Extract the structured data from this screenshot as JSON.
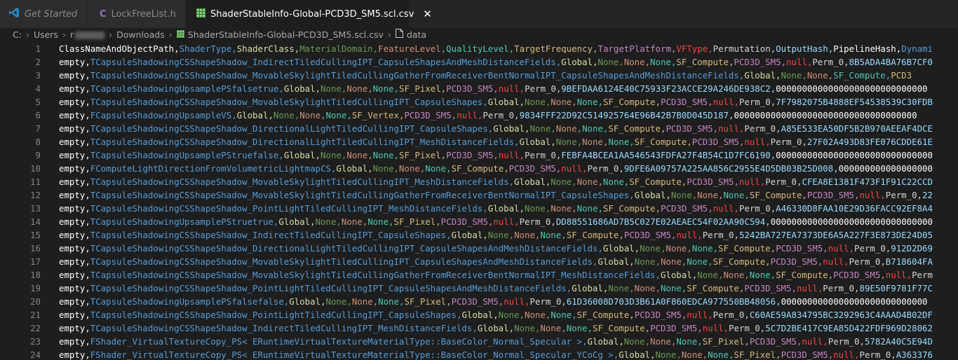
{
  "tabs": [
    {
      "label": "Get Started",
      "icon": "vscode-logo-icon",
      "active": false
    },
    {
      "label": "LockFreeList.h",
      "icon": "c-file-icon",
      "active": false
    },
    {
      "label": "ShaderStableInfo-Global-PCD3D_SM5.scl.csv",
      "icon": "csv-file-icon",
      "active": true
    }
  ],
  "breadcrumb": [
    "C:",
    "Users",
    "r",
    "Downloads",
    "ShaderStableInfo-Global-PCD3D_SM5.scl.csv",
    "data"
  ],
  "colors": {
    "editor_bg": "#1e1e1e",
    "rainbow": [
      "#ffffff",
      "#569cd6",
      "#dcdcaa",
      "#6a9955",
      "#ce9178",
      "#4ec9b0",
      "#d7ba7d",
      "#c586c0",
      "#f44747",
      "#d4d4d4",
      "#9cdcfe"
    ]
  },
  "lines": [
    {
      "n": "1",
      "text": "ClassNameAndObjectPath,ShaderType,ShaderClass,MaterialDomain,FeatureLevel,QualityLevel,TargetFrequency,TargetPlatform,VFType,Permutation,OutputHash,PipelineHash,Dynami"
    },
    {
      "n": "2",
      "text": "empty,TCapsuleShadowingCSShapeShadow_IndirectTiledCullingIPT_CapsuleShapesAndMeshDistanceFields,Global,None,None,None,SF_Compute,PCD3D_SM5,null,Perm_0,8B5ADA4BA76B7CF0"
    },
    {
      "n": "3",
      "text": "empty,TCapsuleShadowingCSShapeShadow_MovableSkylightTiledCullingGatherFromReceiverBentNormalIPT_CapsuleShapesAndMeshDistanceFields,Global,None,None,SF_Compute,PCD3"
    },
    {
      "n": "4",
      "text": "empty,TCapsuleShadowingUpsamplePSfalsetrue,Global,None,None,None,SF_Pixel,PCD3D_SM5,null,Perm_0,9BEFDAA6124E40C75933F23ACCE29A246DE938C2,00000000000000000000000000000"
    },
    {
      "n": "5",
      "text": "empty,TCapsuleShadowingCSShapeShadow_MovableSkylightTiledCullingIPT_CapsuleShapes,Global,None,None,None,SF_Compute,PCD3D_SM5,null,Perm_0,7F7982075B4888EF54538539C30FDB"
    },
    {
      "n": "6",
      "text": "empty,FCapsuleShadowingUpsampleVS,Global,None,None,None,SF_Vertex,PCD3D_SM5,null,Perm_0,9834FFF22D92C514925764E96B42B7B0D045D187,00000000000000000000000000000000000"
    },
    {
      "n": "7",
      "text": "empty,TCapsuleShadowingCSShapeShadow_DirectionalLightTiledCullingIPT_CapsuleShapes,Global,None,None,None,SF_Compute,PCD3D_SM5,null,Perm_0,A85E533EA50DF5B2B970AEEAF4DCE"
    },
    {
      "n": "8",
      "text": "empty,TCapsuleShadowingCSShapeShadow_DirectionalLightTiledCullingIPT_MeshDistanceFields,Global,None,None,None,SF_Compute,PCD3D_SM5,null,Perm_0,27F02A493D83FE076CDDE61E"
    },
    {
      "n": "9",
      "text": "empty,TCapsuleShadowingUpsamplePStruefalse,Global,None,None,None,SF_Pixel,PCD3D_SM5,null,Perm_0,FEBFA4BCEA1AA546543FDFA27F4B54C1D7FC6190,000000000000000000000000000000"
    },
    {
      "n": "10",
      "text": "empty,FComputeLightDirectionFromVolumetricLightmapCS,Global,None,None,None,SF_Compute,PCD3D_SM5,null,Perm_0,9DFE6A09757A225AA856C2955E4D5DB03B25D008,000000000000000000"
    },
    {
      "n": "11",
      "text": "empty,TCapsuleShadowingCSShapeShadow_MovableSkylightTiledCullingIPT_MeshDistanceFields,Global,None,None,None,SF_Compute,PCD3D_SM5,null,Perm_0,CFEA8E1381F473F1F91C22CCD"
    },
    {
      "n": "12",
      "text": "empty,TCapsuleShadowingCSShapeShadow_MovableSkylightTiledCullingGatherFromReceiverBentNormalIPT_CapsuleShapes,Global,None,None,None,SF_Compute,PCD3D_SM5,null,Perm_0,22"
    },
    {
      "n": "13",
      "text": "empty,TCapsuleShadowingCSShapeShadow_PointLightTiledCullingIPT_MeshDistanceFields,Global,None,None,None,SF_Compute,PCD3D_SM5,null,Perm_0,A46330D8FAA10E29D36FACC92EF8A4"
    },
    {
      "n": "14",
      "text": "empty,TCapsuleShadowingUpsamplePStruetrue,Global,None,None,None,SF_Pixel,PCD3D_SM5,null,Perm_0,DD88551686AD7B5C027E02AEAEC54F02AA90C594,0000000000000000000000000000000"
    },
    {
      "n": "15",
      "text": "empty,TCapsuleShadowingCSShapeShadow_IndirectTiledCullingIPT_CapsuleShapes,Global,None,None,None,SF_Compute,PCD3D_SM5,null,Perm_0,5242BA727EA7373DE6A5A227F3E873DE24D05"
    },
    {
      "n": "16",
      "text": "empty,TCapsuleShadowingCSShapeShadow_DirectionalLightTiledCullingIPT_CapsuleShapesAndMeshDistanceFields,Global,None,None,None,SF_Compute,PCD3D_SM5,null,Perm_0,912D2D69"
    },
    {
      "n": "17",
      "text": "empty,TCapsuleShadowingCSShapeShadow_MovableSkylightTiledCullingIPT_CapsuleShapesAndMeshDistanceFields,Global,None,None,None,SF_Compute,PCD3D_SM5,null,Perm_0,B718604FA"
    },
    {
      "n": "18",
      "text": "empty,TCapsuleShadowingCSShapeShadow_MovableSkylightTiledCullingGatherFromReceiverBentNormalIPT_MeshDistanceFields,Global,None,None,None,SF_Compute,PCD3D_SM5,null,Perm"
    },
    {
      "n": "19",
      "text": "empty,TCapsuleShadowingCSShapeShadow_PointLightTiledCullingIPT_CapsuleShapesAndMeshDistanceFields,Global,None,None,None,SF_Compute,PCD3D_SM5,null,Perm_0,89E50F9781F77C"
    },
    {
      "n": "20",
      "text": "empty,TCapsuleShadowingUpsamplePSfalsefalse,Global,None,None,None,SF_Pixel,PCD3D_SM5,null,Perm_0,61D36008D703D3B61A0F860EDCA977550BB48056,0000000000000000000000000000"
    },
    {
      "n": "21",
      "text": "empty,TCapsuleShadowingCSShapeShadow_PointLightTiledCullingIPT_CapsuleShapes,Global,None,None,None,SF_Compute,PCD3D_SM5,null,Perm_0,C60AE59A834795BC3292963C4AAAD4B02DF"
    },
    {
      "n": "22",
      "text": "empty,TCapsuleShadowingCSShapeShadow_IndirectTiledCullingIPT_MeshDistanceFields,Global,None,None,None,SF_Compute,PCD3D_SM5,null,Perm_0,5C7D2BE417C9EA85D422FDF969D28062"
    },
    {
      "n": "23",
      "text": "empty,FShader_VirtualTextureCopy_PS< ERuntimeVirtualTextureMaterialType::BaseColor_Normal_Specular >,Global,None,None,None,SF_Pixel,PCD3D_SM5,null,Perm_0,5782A40C5E94D"
    },
    {
      "n": "24",
      "text": "empty,FShader_VirtualTextureCopy_PS< ERuntimeVirtualTextureMaterialType::BaseColor_Normal_Specular_YCoCg >,Global,None,None,None,SF_Pixel,PCD3D_SM5,null,Perm_0,A363376"
    }
  ]
}
